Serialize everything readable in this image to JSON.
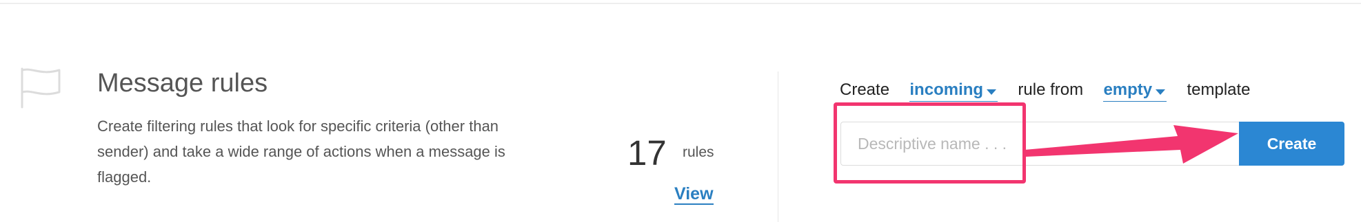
{
  "section": {
    "title": "Message rules",
    "description": "Create filtering rules that look for specific criteria (other than sender) and take a wide range of actions when a message is flagged.",
    "icon": "flag-icon"
  },
  "stats": {
    "count": "17",
    "count_label": "rules",
    "view_label": "View"
  },
  "create_form": {
    "prefix": "Create",
    "direction_value": "incoming",
    "middle": "rule from",
    "template_value": "empty",
    "suffix": "template",
    "name_placeholder": "Descriptive name . . .",
    "name_value": "",
    "create_label": "Create"
  },
  "annotation": {
    "highlight_color": "#f2356f",
    "arrow_color": "#f2356f"
  },
  "colors": {
    "accent": "#2a7fc1",
    "button": "#2b87d3"
  }
}
